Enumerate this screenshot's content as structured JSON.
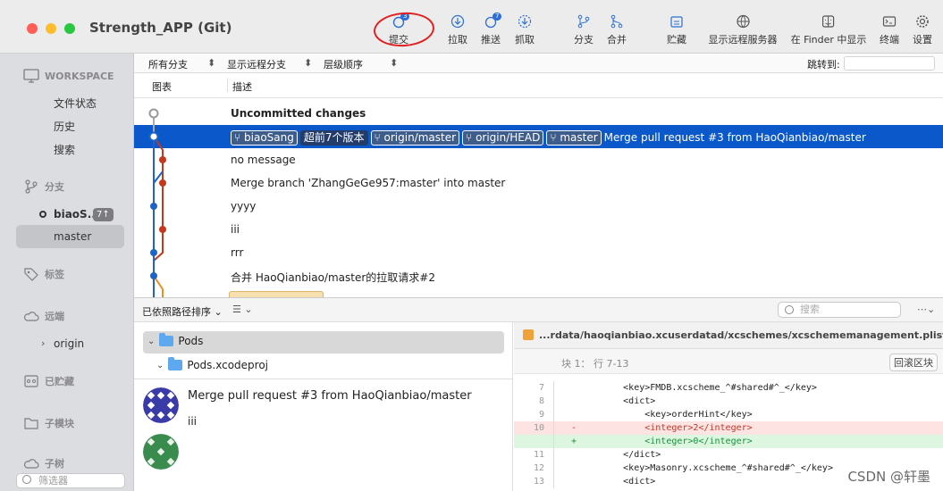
{
  "window": {
    "title": "Strength_APP (Git)",
    "colors": {
      "close": "#fe5f57",
      "minimize": "#febc2e",
      "zoom": "#28c840",
      "selection": "#0a58ca",
      "annotation": "#e02020"
    }
  },
  "toolbar": {
    "commit": {
      "label": "提交",
      "badge": "3",
      "icon": "commit-icon"
    },
    "pull": {
      "label": "拉取",
      "icon": "pull-icon"
    },
    "push": {
      "label": "推送",
      "badge": "7",
      "icon": "push-icon"
    },
    "fetch": {
      "label": "抓取",
      "icon": "fetch-icon"
    },
    "branch": {
      "label": "分支",
      "icon": "branch-icon"
    },
    "merge": {
      "label": "合并",
      "icon": "merge-icon"
    },
    "stash": {
      "label": "贮藏",
      "icon": "stash-icon"
    },
    "remote": {
      "label": "显示远程服务器",
      "icon": "globe-icon"
    },
    "finder": {
      "label": "在 Finder 中显示",
      "icon": "finder-icon"
    },
    "terminal": {
      "label": "终端",
      "icon": "terminal-icon"
    },
    "settings": {
      "label": "设置",
      "icon": "gear-icon"
    }
  },
  "sidebar": {
    "workspace": "WORKSPACE",
    "workspace_items": [
      "文件状态",
      "历史",
      "搜索"
    ],
    "branches_header": "分支",
    "current_branch": "biaoS...",
    "current_branch_badge": "7↑",
    "branch_master": "master",
    "tags_header": "标签",
    "remotes_header": "远端",
    "remote_origin": "origin",
    "stashes_header": "已贮藏",
    "submodules_header": "子模块",
    "subtrees_header": "子树",
    "filter_placeholder": "筛选器"
  },
  "options_bar": {
    "all_branches": "所有分支",
    "show_remote": "显示远程分支",
    "order": "层级顺序",
    "jump_to": "跳转到:"
  },
  "columns": {
    "graph": "图表",
    "description": "描述"
  },
  "history": {
    "uncommitted": "Uncommitted changes",
    "selected_tags": [
      "biaoSang",
      "超前7个版本",
      "origin/master",
      "origin/HEAD",
      "master"
    ],
    "selected_message": "Merge pull request #3 from HaoQianbiao/master",
    "rows": [
      "no message",
      "Merge branch 'ZhangGeGe957:master' into master",
      "yyyy",
      "iii",
      "rrr",
      "合并 HaoQianbiao/master的拉取请求#2"
    ]
  },
  "bottom_toolbar": {
    "sort": "已依照路径排序",
    "search_placeholder": "搜索"
  },
  "files": {
    "pods": "Pods",
    "xcodeproj": "Pods.xcodeproj"
  },
  "commit_detail": {
    "message": "Merge pull request #3 from HaoQianbiao/master",
    "body": "iii"
  },
  "diff": {
    "file_path": "...rdata/haoqianbiao.xcuserdatad/xcschemes/xcschememanagement.plist",
    "hunk_label": "块 1： 行 7-13",
    "hunk_button": "回滚区块",
    "lines": [
      {
        "num": "7",
        "sign": "",
        "code": "        <key>FMDB.xcscheme_^#shared#^_</key>",
        "type": "ctx"
      },
      {
        "num": "8",
        "sign": "",
        "code": "        <dict>",
        "type": "ctx"
      },
      {
        "num": "9",
        "sign": "",
        "code": "            <key>orderHint</key>",
        "type": "ctx"
      },
      {
        "num": "10",
        "sign": "-",
        "code": "            <integer>2</integer>",
        "type": "del"
      },
      {
        "num": "",
        "sign": "+",
        "code": "            <integer>0</integer>",
        "type": "add"
      },
      {
        "num": "11",
        "sign": "",
        "code": "        </dict>",
        "type": "ctx"
      },
      {
        "num": "12",
        "sign": "",
        "code": "        <key>Masonry.xcscheme_^#shared#^_</key>",
        "type": "ctx"
      },
      {
        "num": "13",
        "sign": "",
        "code": "        <dict>",
        "type": "ctx"
      }
    ]
  },
  "watermark": "CSDN @轩墨"
}
